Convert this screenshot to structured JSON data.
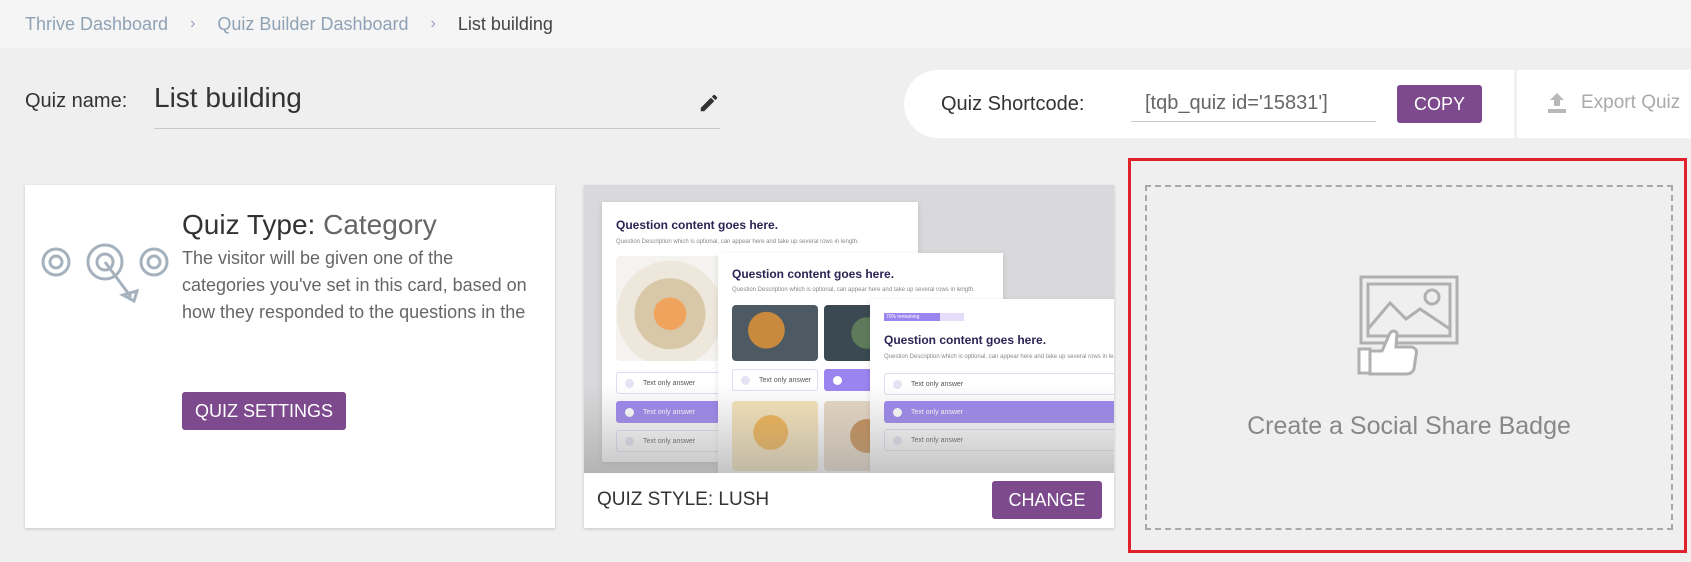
{
  "breadcrumb": {
    "items": [
      "Thrive Dashboard",
      "Quiz Builder Dashboard"
    ],
    "separator": "›",
    "current": "List building"
  },
  "quiz": {
    "name_label": "Quiz name:",
    "name": "List building"
  },
  "shortcode": {
    "label": "Quiz Shortcode:",
    "value": "[tqb_quiz id='15831']",
    "copy_label": "COPY",
    "export_label": "Export Quiz"
  },
  "quiz_type": {
    "title_prefix": "Quiz Type:",
    "title_value": "Category",
    "description": "The visitor will be given one of the categories you've set in this card, based on how they responded to the questions in the quiz.",
    "settings_label": "QUIZ SETTINGS"
  },
  "quiz_style": {
    "label": "QUIZ STYLE: LUSH",
    "change_label": "CHANGE",
    "preview": {
      "question": "Question content goes here.",
      "description": "Question Description which is optional, can appear here and take up several rows in length.",
      "answer": "Text only answer",
      "progress": "70% remaining"
    }
  },
  "social_badge": {
    "label": "Create a Social Share Badge"
  },
  "colors": {
    "accent": "#7d4a8d",
    "highlight": "#e0202a",
    "answer_selected": "#9a84f0"
  }
}
